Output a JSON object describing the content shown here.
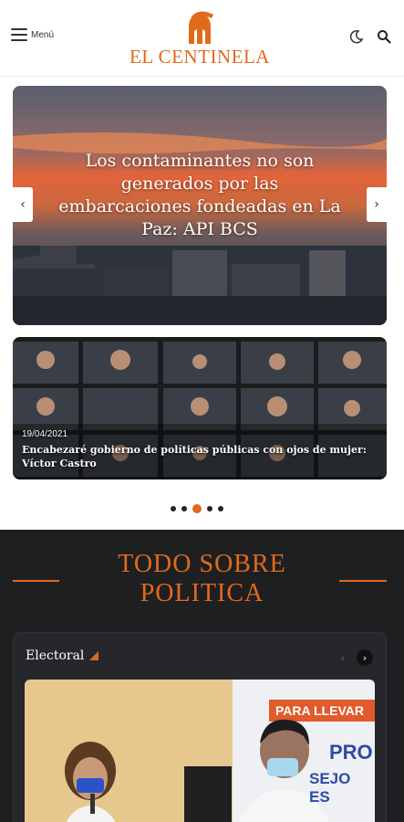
{
  "header": {
    "menu_label": "Menú",
    "logo_text": "EL CENTINELA",
    "icons": [
      "menu-icon",
      "moon-icon",
      "search-icon"
    ]
  },
  "slider": {
    "slides": [
      {
        "title": "Los contaminantes no son generados por las embarcaciones fondeadas en La Paz: API BCS"
      },
      {
        "date": "19/04/2021",
        "title": "Encabezaré gobierno de políticas públicas con ojos de mujer: Víctor Castro"
      }
    ],
    "dots_total": 5,
    "active_dot": 3
  },
  "section": {
    "title_line1": "TODO SOBRE",
    "title_line2": "POLITICA"
  },
  "card": {
    "label": "Electoral",
    "banner_text1": "PARA LLEVAR",
    "banner_text2": "PRO",
    "banner_text3": "SEJO ES"
  },
  "colors": {
    "accent": "#e06a1c",
    "dark_bg": "#1e1f21",
    "card_bg": "#26272a"
  }
}
